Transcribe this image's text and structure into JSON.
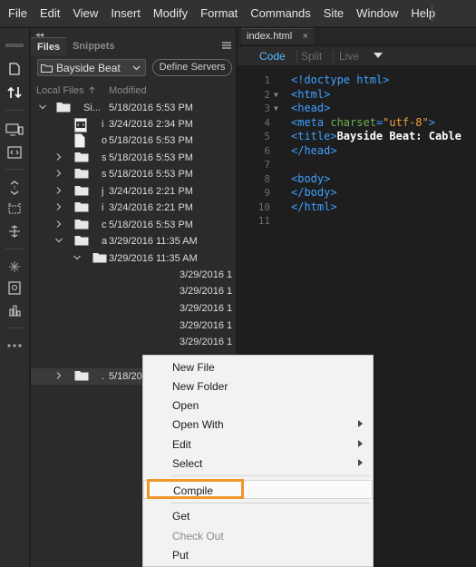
{
  "menubar": {
    "items": [
      "File",
      "Edit",
      "View",
      "Insert",
      "Modify",
      "Format",
      "Commands",
      "Site",
      "Window",
      "Help"
    ]
  },
  "toolbar": {
    "icons": [
      "document-icon",
      "file-transfer-icon",
      "device-preview-icon",
      "live-code-icon",
      "expand-collapse-icon",
      "select-element-icon",
      "move-icon",
      "sparkle-icon",
      "inspect-icon",
      "css-designer-icon",
      "more-icon"
    ]
  },
  "files_panel": {
    "collapse_label": "◂◂",
    "tabs": [
      "Files",
      "Snippets"
    ],
    "site_select": "Bayside Beat",
    "define_servers": "Define Servers",
    "col_local": "Local Files",
    "col_modified": "Modified",
    "rows": [
      {
        "name": "Si...",
        "date": "5/18/2016 5:53 PM"
      },
      {
        "name": "i",
        "date": "3/24/2016 2:34 PM"
      },
      {
        "name": "o",
        "date": "5/18/2016 5:53 PM"
      },
      {
        "name": "s",
        "date": "5/18/2016 5:53 PM"
      },
      {
        "name": "s",
        "date": "5/18/2016 5:53 PM"
      },
      {
        "name": "j",
        "date": "3/24/2016 2:21 PM"
      },
      {
        "name": "i",
        "date": "3/24/2016 2:21 PM"
      },
      {
        "name": "c",
        "date": "5/18/2016 5:53 PM"
      },
      {
        "name": "a",
        "date": "3/29/2016 11:35 AM"
      },
      {
        "name": "",
        "date": "3/29/2016 11:35 AM"
      },
      {
        "name": "",
        "date": "3/29/2016 1"
      },
      {
        "name": "",
        "date": "3/29/2016 1"
      },
      {
        "name": "",
        "date": "3/29/2016 1"
      },
      {
        "name": "",
        "date": "3/29/2016 1"
      },
      {
        "name": "",
        "date": "3/29/2016 1"
      },
      {
        "name": ".",
        "date": "5/18/20"
      }
    ]
  },
  "document": {
    "tab_label": "index.html",
    "tab_close": "×",
    "views": [
      "Code",
      "Split",
      "Live"
    ]
  },
  "editor": {
    "line_numbers": [
      "1",
      "2",
      "3",
      "4",
      "5",
      "6",
      "7",
      "8",
      "9",
      "10",
      "11"
    ],
    "lines": [
      {
        "tag1": "<!doctype html>"
      },
      {
        "tag1": "<html>"
      },
      {
        "tag1": "<head>"
      },
      {
        "tag1": "<meta ",
        "attr": "charset",
        "eq": "=",
        "str": "\"utf-8\"",
        "tag2": ">"
      },
      {
        "tag1": "<title>",
        "txt": "Bayside Beat: Cable"
      },
      {
        "tag1": "</head>"
      },
      {},
      {
        "tag1": "<body>"
      },
      {
        "tag1": "</body>"
      },
      {
        "tag1": "</html>"
      },
      {}
    ]
  },
  "context_menu": {
    "items": [
      {
        "label": "New File"
      },
      {
        "label": "New Folder"
      },
      {
        "label": "Open"
      },
      {
        "label": "Open With"
      },
      {
        "label": "Edit"
      },
      {
        "label": "Select"
      },
      {
        "label": "Compile"
      },
      {
        "label": "Get"
      },
      {
        "label": "Check Out"
      },
      {
        "label": "Put"
      }
    ]
  },
  "colors": {
    "accent_blue": "#56b9ff",
    "highlight_orange": "#f0962a"
  }
}
